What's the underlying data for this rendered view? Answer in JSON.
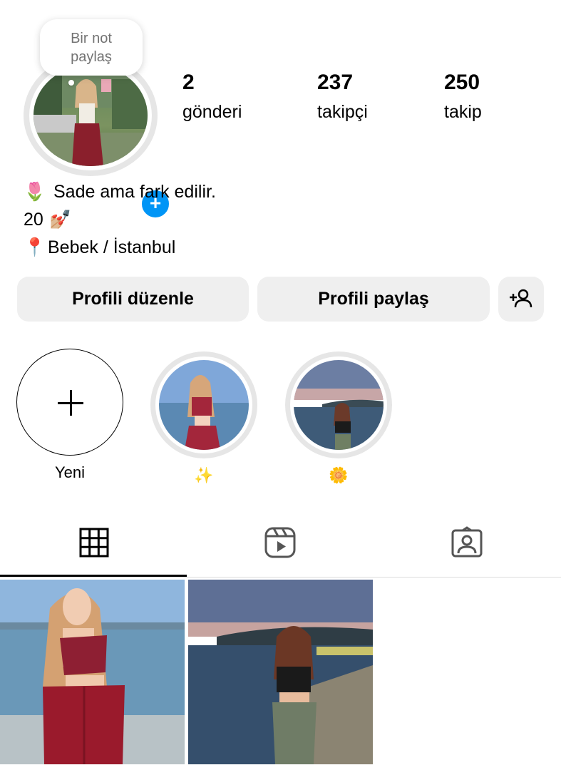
{
  "profile": {
    "note_text": "Bir not paylaş",
    "stats": [
      {
        "value": "2",
        "label": "gönderi"
      },
      {
        "value": "237",
        "label": "takipçi"
      },
      {
        "value": "250",
        "label": "takip"
      }
    ],
    "bio": [
      {
        "emoji": "🌷",
        "text": "Sade ama fark edilir."
      },
      {
        "emoji": "💅🏼",
        "text": "20",
        "emoji_after": true
      },
      {
        "emoji": "📍",
        "text": "Bebek / İstanbul"
      }
    ]
  },
  "actions": {
    "edit_label": "Profili düzenle",
    "share_label": "Profili paylaş",
    "add_person_icon": "add-person-icon"
  },
  "highlights": [
    {
      "label": "Yeni",
      "type": "new"
    },
    {
      "label": "✨",
      "type": "story"
    },
    {
      "label": "🌼",
      "type": "story"
    }
  ],
  "tabs": [
    {
      "icon": "grid-icon",
      "active": true
    },
    {
      "icon": "reels-icon",
      "active": false
    },
    {
      "icon": "tagged-icon",
      "active": false
    }
  ],
  "colors": {
    "accent": "#0095f6",
    "button_bg": "#efefef",
    "ring": "#e6e6e6"
  }
}
